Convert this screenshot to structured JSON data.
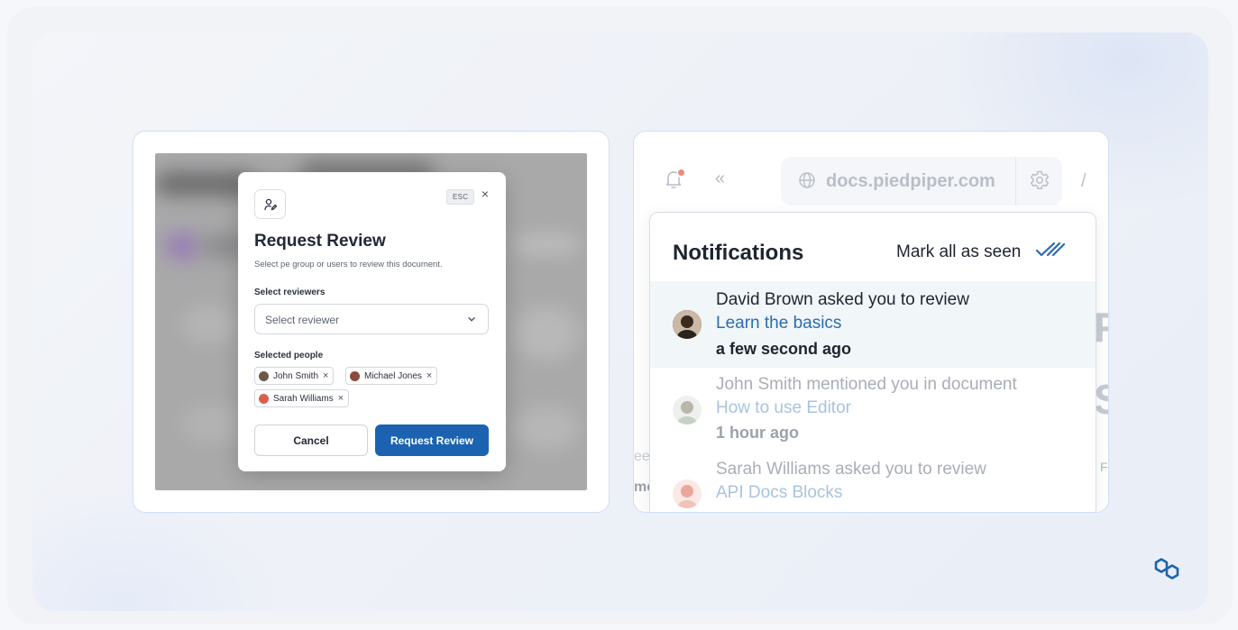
{
  "review_modal": {
    "esc_label": "ESC",
    "close_glyph": "×",
    "title": "Request Review",
    "subtitle": "Select pe group or users to review this document.",
    "reviewers_label": "Select reviewers",
    "reviewer_placeholder": "Select reviewer",
    "selected_label": "Selected people",
    "selected_people": [
      {
        "name": "John Smith",
        "avatar_color": "#6b5a4a"
      },
      {
        "name": "Michael Jones",
        "avatar_color": "#8a4b3c"
      },
      {
        "name": "Sarah Williams",
        "avatar_color": "#d9604f"
      }
    ],
    "remove_glyph": "×",
    "cancel_label": "Cancel",
    "submit_label": "Request Review",
    "primary_color": "#1b63b0"
  },
  "topbar": {
    "collapse_glyph": "«",
    "url": "docs.piedpiper.com",
    "slash": "/"
  },
  "background_fragments": {
    "letter_1": "F",
    "letter_2": "S",
    "left_1": "ee",
    "left_2": "mc",
    "right_1": "F"
  },
  "notifications": {
    "title": "Notifications",
    "mark_all_label": "Mark all as seen",
    "items": [
      {
        "text": "David Brown asked you to review",
        "doc": "Learn the basics",
        "time": "a few second ago",
        "state": "unread"
      },
      {
        "text": "John Smith mentioned you in document",
        "doc": "How to use Editor",
        "time": "1 hour ago",
        "state": "read"
      },
      {
        "text": "Sarah Williams asked you to review",
        "doc": "API Docs Blocks",
        "time": "",
        "state": "read"
      }
    ],
    "accent_color": "#2a6cb4"
  },
  "icons": {
    "bell": "bell-icon",
    "globe": "globe-icon",
    "gear": "gear-icon",
    "double_check": "double-check-icon",
    "brand": "brand-logo-icon"
  }
}
